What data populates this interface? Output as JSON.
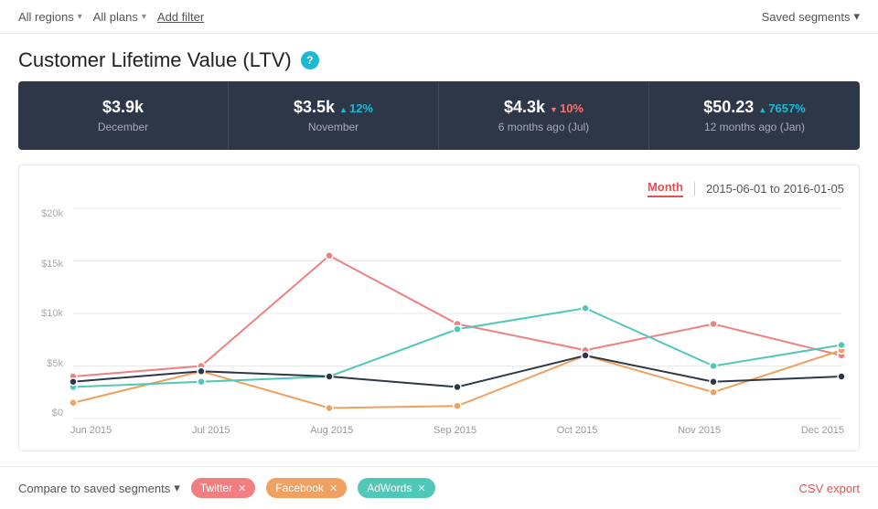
{
  "topbar": {
    "all_regions_label": "All regions",
    "all_plans_label": "All plans",
    "add_filter_label": "Add filter",
    "saved_segments_label": "Saved segments"
  },
  "header": {
    "title": "Customer Lifetime Value (LTV)",
    "help_tooltip": "?"
  },
  "stats": [
    {
      "value": "$3.9k",
      "label": "December",
      "change": null,
      "change_type": null
    },
    {
      "value": "$3.5k",
      "label": "November",
      "change": "12%",
      "change_type": "up"
    },
    {
      "value": "$4.3k",
      "label": "6 months ago (Jul)",
      "change": "10%",
      "change_type": "down"
    },
    {
      "value": "$50.23",
      "label": "12 months ago (Jan)",
      "change": "7657%",
      "change_type": "up"
    }
  ],
  "chart": {
    "period_label": "Month",
    "date_range": "2015-06-01 to 2016-01-05",
    "y_labels": [
      "$20k",
      "$15k",
      "$10k",
      "$5k",
      "$0"
    ],
    "x_labels": [
      "Jun 2015",
      "Jul 2015",
      "Aug 2015",
      "Sep 2015",
      "Oct 2015",
      "Nov 2015",
      "Dec 2015"
    ]
  },
  "bottom": {
    "compare_label": "Compare to saved segments",
    "segments": [
      {
        "name": "Twitter",
        "color_class": "tag-twitter"
      },
      {
        "name": "Facebook",
        "color_class": "tag-facebook"
      },
      {
        "name": "AdWords",
        "color_class": "tag-adwords"
      }
    ],
    "csv_export_label": "CSV export"
  }
}
